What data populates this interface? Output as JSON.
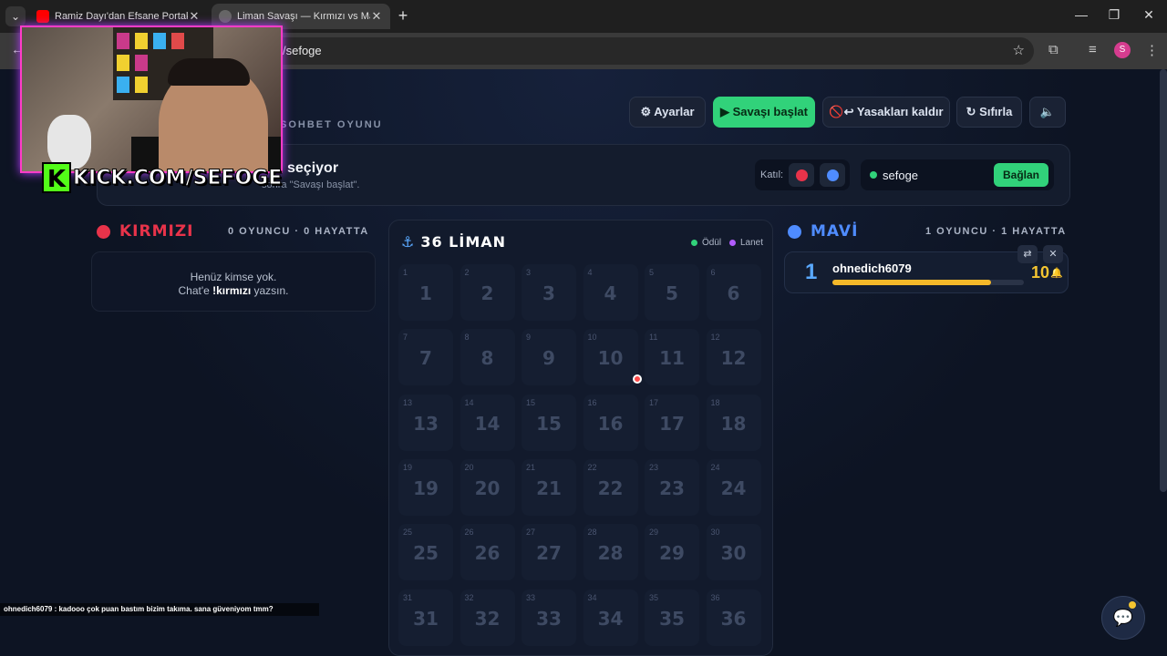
{
  "browser": {
    "tabs": [
      {
        "title": "Ramiz Dayı'dan Efsane Portakal",
        "favicon_color": "#ff0000"
      },
      {
        "title": "Liman Savaşı — Kırmızı vs Mavi",
        "favicon_color": "#888888"
      }
    ],
    "url_fragment": "/sefoge",
    "profile_initial": "S"
  },
  "header": {
    "subtitle": "SOHBET OYUNU",
    "buttons": {
      "settings": "⚙ Ayarlar",
      "start": "▶ Savaşı başlat",
      "bans": "🚫↩ Yasakları kaldır",
      "reset": "↻ Sıfırla",
      "sound": "🔈"
    }
  },
  "status": {
    "title": "seçiyor",
    "subtitle": "sonra \"Savaşı başlat\".",
    "join_label": "Katıl:",
    "channel": "sefoge",
    "connect_label": "Bağlan"
  },
  "red_team": {
    "name": "KIRMIZI",
    "color": "#e8334a",
    "stats": "0 OYUNCU · 0 HAYATTA",
    "empty_line1": "Henüz kimse yok.",
    "empty_line2_prefix": "Chat'e ",
    "empty_command": "!kırmızı",
    "empty_line2_suffix": " yazsın."
  },
  "blue_team": {
    "name": "MAVİ",
    "color": "#4f8cff",
    "stats": "1 OYUNCU · 1 HAYATTA",
    "players": [
      {
        "rank": "1",
        "name": "ohnedich6079",
        "lives": "10",
        "progress": 0.83
      }
    ]
  },
  "grid": {
    "title": "36 LİMAN",
    "legend": [
      {
        "label": "Ödül",
        "color": "#31d27a"
      },
      {
        "label": "Lanet",
        "color": "#b15cff"
      }
    ],
    "cells": [
      "1",
      "2",
      "3",
      "4",
      "5",
      "6",
      "7",
      "8",
      "9",
      "10",
      "11",
      "12",
      "13",
      "14",
      "15",
      "16",
      "17",
      "18",
      "19",
      "20",
      "21",
      "22",
      "23",
      "24",
      "25",
      "26",
      "27",
      "28",
      "29",
      "30",
      "31",
      "32",
      "33",
      "34",
      "35",
      "36"
    ]
  },
  "overlay": {
    "kick_letter": "K",
    "kick_text": "KICK.COM/SEFOGE",
    "chat_message": "ohnedich6079 : kadooo çok puan bastım bizim takıma. sana güveniyom tmm?"
  }
}
